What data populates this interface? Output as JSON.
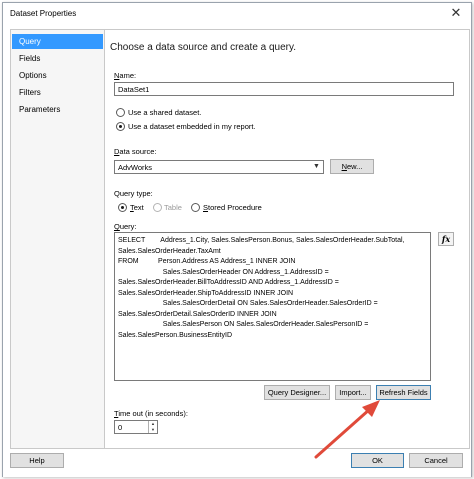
{
  "window": {
    "title": "Dataset Properties",
    "close_glyph": "✕"
  },
  "sidebar": {
    "items": [
      {
        "label": "Query"
      },
      {
        "label": "Fields"
      },
      {
        "label": "Options"
      },
      {
        "label": "Filters"
      },
      {
        "label": "Parameters"
      }
    ]
  },
  "main": {
    "heading": "Choose a data source and create a query.",
    "name_label_u": "N",
    "name_label_rest": "ame:",
    "name_value": "DataSet1",
    "radio_shared": "Use a shared dataset.",
    "radio_embedded": "Use a dataset embedded in my report.",
    "datasource_label_u": "D",
    "datasource_label_rest": "ata source:",
    "datasource_value": "AdvWorks",
    "new_button_u": "N",
    "new_button_rest": "ew...",
    "query_type_label": "Query type:",
    "qt_text_u": "T",
    "qt_text_rest": "ext",
    "qt_table": "Table",
    "qt_sp_u": "S",
    "qt_sp_rest": "tored Procedure",
    "query_label_u": "Q",
    "query_label_rest": "uery:",
    "query_text": "SELECT        Address_1.City, Sales.SalesPerson.Bonus, Sales.SalesOrderHeader.SubTotal,\nSales.SalesOrderHeader.TaxAmt\nFROM          Person.Address AS Address_1 INNER JOIN\n                       Sales.SalesOrderHeader ON Address_1.AddressID =\nSales.SalesOrderHeader.BillToAddressID AND Address_1.AddressID =\nSales.SalesOrderHeader.ShipToAddressID INNER JOIN\n                       Sales.SalesOrderDetail ON Sales.SalesOrderHeader.SalesOrderID =\nSales.SalesOrderDetail.SalesOrderID INNER JOIN\n                       Sales.SalesPerson ON Sales.SalesOrderHeader.SalesPersonID =\nSales.SalesPerson.BusinessEntityID",
    "fx_label": "fx",
    "query_designer_button": "Query Designer...",
    "import_button": "Import...",
    "refresh_fields_button": "Refresh Fields",
    "timeout_label_u": "T",
    "timeout_label_rest": "ime out (in seconds):",
    "timeout_value": "0"
  },
  "footer": {
    "help": "Help",
    "ok": "OK",
    "cancel": "Cancel"
  },
  "colors": {
    "selection": "#3399ff",
    "arrow": "#e04a3a"
  }
}
